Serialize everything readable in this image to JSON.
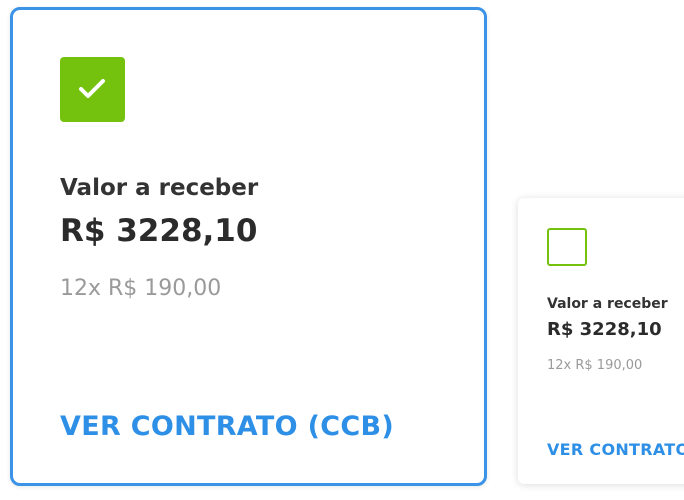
{
  "colors": {
    "accent_blue": "#2e8fe6",
    "selected_border": "#3a93e6",
    "check_green": "#74c10e",
    "muted_text": "#9a9a9a"
  },
  "cards": [
    {
      "selected": true,
      "check_icon": "checkmark-icon",
      "label": "Valor a receber",
      "amount": "R$ 3228,10",
      "installments": "12x R$ 190,00",
      "contract_link": "VER CONTRATO (CCB)"
    },
    {
      "selected": false,
      "label": "Valor a receber",
      "amount": "R$ 3228,10",
      "installments": "12x R$ 190,00",
      "contract_link": "VER CONTRATO"
    }
  ]
}
